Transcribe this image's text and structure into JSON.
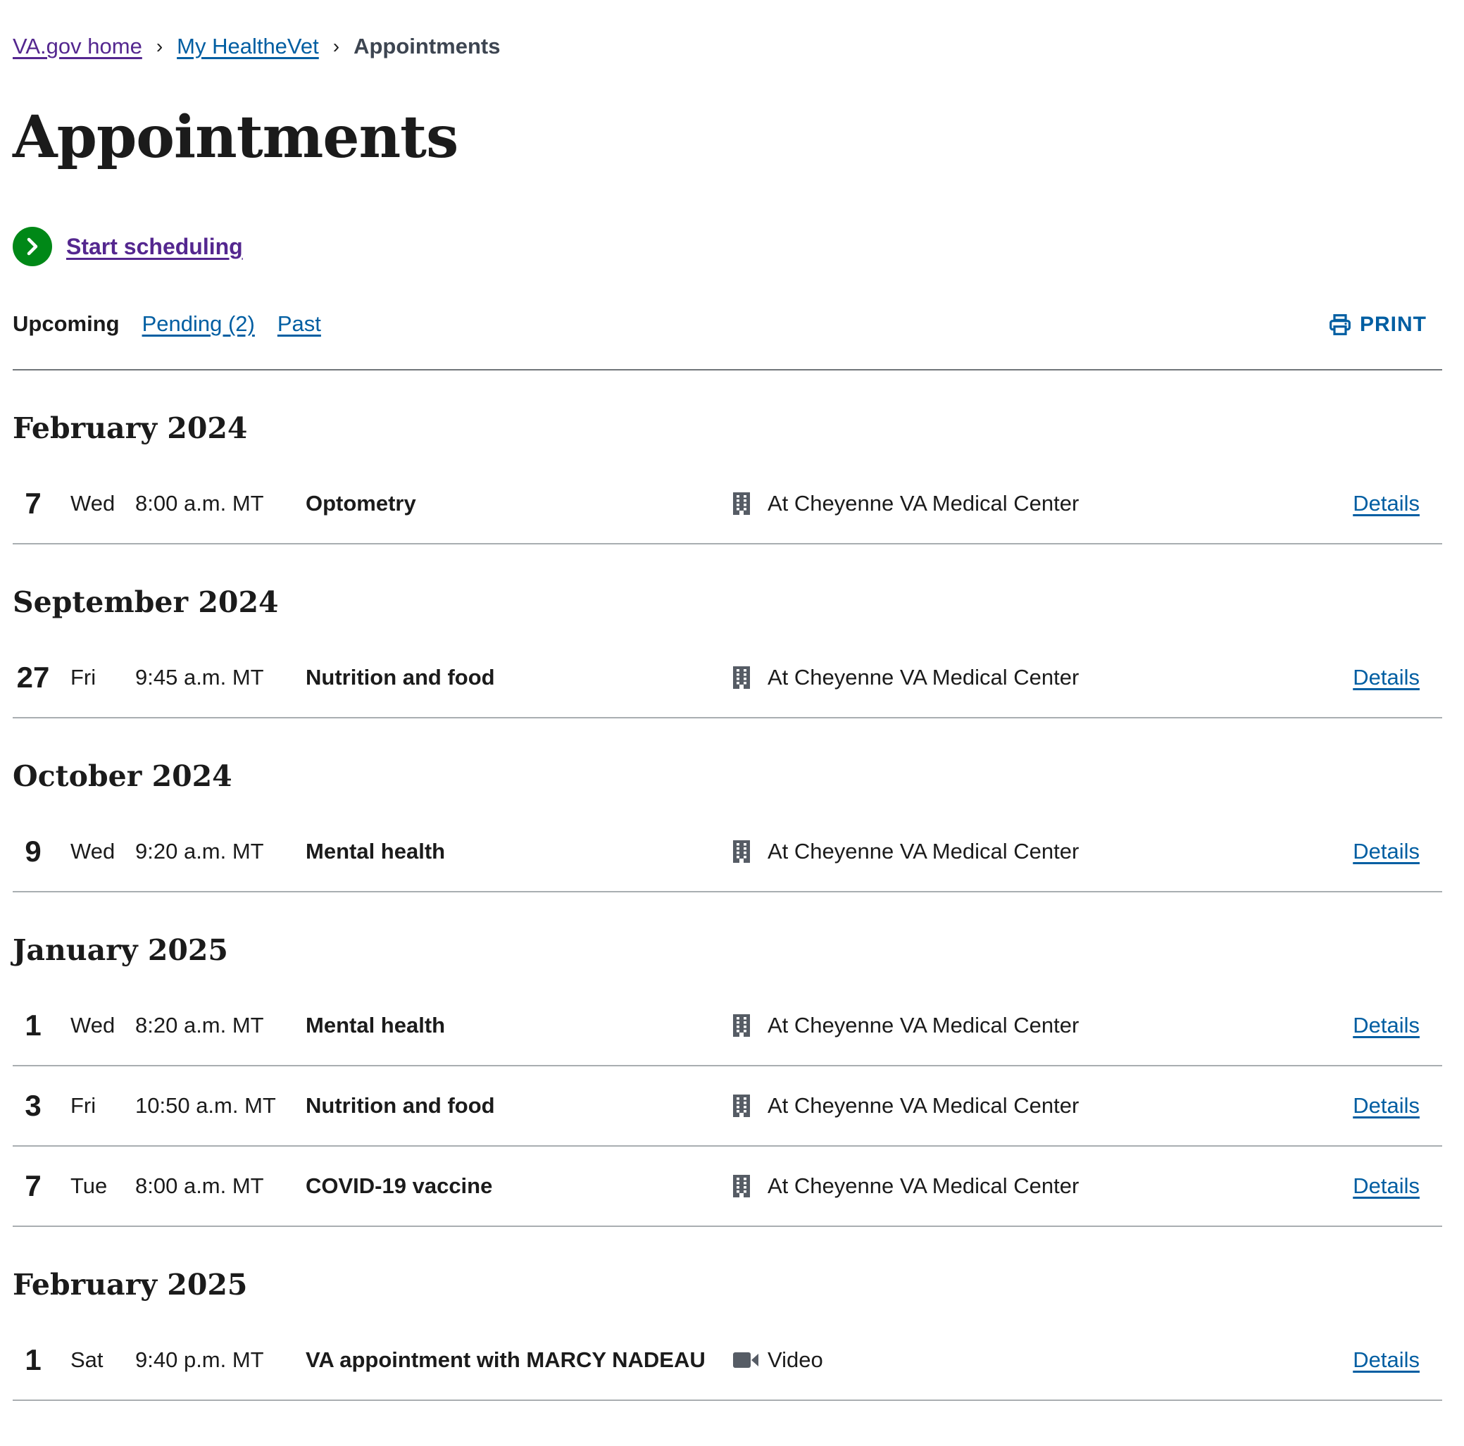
{
  "breadcrumb": {
    "home": "VA.gov home",
    "myhealthevet": "My HealtheVet",
    "current": "Appointments",
    "separator": "›"
  },
  "page": {
    "title": "Appointments",
    "start_scheduling": "Start scheduling"
  },
  "tabs": {
    "upcoming": "Upcoming",
    "pending": "Pending (2)",
    "past": "Past",
    "print": "PRINT"
  },
  "colors": {
    "link_blue": "#005ea2",
    "visited_purple": "#54278f",
    "start_green": "#008817",
    "icon_gray": "#565c65",
    "divider": "#a9aeb1"
  },
  "months": [
    {
      "label": "February 2024",
      "appointments": [
        {
          "day": "7",
          "weekday": "Wed",
          "time": "8:00 a.m. MT",
          "type": "Optometry",
          "location_icon": "building-icon",
          "location": "At Cheyenne VA Medical Center",
          "details": "Details"
        }
      ]
    },
    {
      "label": "September 2024",
      "appointments": [
        {
          "day": "27",
          "weekday": "Fri",
          "time": "9:45 a.m. MT",
          "type": "Nutrition and food",
          "location_icon": "building-icon",
          "location": "At Cheyenne VA Medical Center",
          "details": "Details"
        }
      ]
    },
    {
      "label": "October 2024",
      "appointments": [
        {
          "day": "9",
          "weekday": "Wed",
          "time": "9:20 a.m. MT",
          "type": "Mental health",
          "location_icon": "building-icon",
          "location": "At Cheyenne VA Medical Center",
          "details": "Details"
        }
      ]
    },
    {
      "label": "January 2025",
      "appointments": [
        {
          "day": "1",
          "weekday": "Wed",
          "time": "8:20 a.m. MT",
          "type": "Mental health",
          "location_icon": "building-icon",
          "location": "At Cheyenne VA Medical Center",
          "details": "Details"
        },
        {
          "day": "3",
          "weekday": "Fri",
          "time": "10:50 a.m. MT",
          "type": "Nutrition and food",
          "location_icon": "building-icon",
          "location": "At Cheyenne VA Medical Center",
          "details": "Details"
        },
        {
          "day": "7",
          "weekday": "Tue",
          "time": "8:00 a.m. MT",
          "type": "COVID-19 vaccine",
          "location_icon": "building-icon",
          "location": "At Cheyenne VA Medical Center",
          "details": "Details"
        }
      ]
    },
    {
      "label": "February 2025",
      "appointments": [
        {
          "day": "1",
          "weekday": "Sat",
          "time": "9:40 p.m. MT",
          "type": "VA appointment with MARCY NADEAU",
          "location_icon": "video-camera-icon",
          "location": "Video",
          "details": "Details"
        }
      ]
    }
  ]
}
